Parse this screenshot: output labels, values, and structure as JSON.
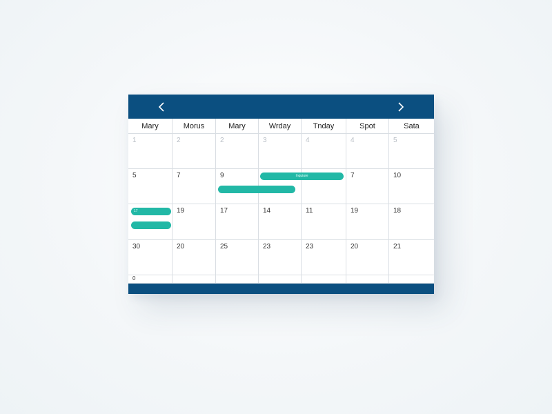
{
  "nav": {
    "prev_icon": "chevron-left-icon",
    "next_icon": "chevron-right-icon"
  },
  "weekdays": [
    "Mary",
    "Morus",
    "Mary",
    "Wrday",
    "Tnday",
    "Spot",
    "Sata"
  ],
  "weeks": [
    [
      "1",
      "2",
      "2",
      "3",
      "4",
      "4",
      "5"
    ],
    [
      "5",
      "7",
      "9",
      "",
      "",
      "7",
      "10"
    ],
    [
      "",
      "19",
      "17",
      "14",
      "11",
      "19",
      "18"
    ],
    [
      "30",
      "20",
      "25",
      "23",
      "23",
      "20",
      "21"
    ],
    [
      "0",
      "",
      "",
      "",
      "",
      "",
      ""
    ]
  ],
  "events": [
    {
      "label": "Inquiure"
    },
    {
      "label": ""
    },
    {
      "label": "17"
    },
    {
      "label": ""
    }
  ],
  "colors": {
    "header": "#0b4f80",
    "event": "#22b8a6",
    "grid_line": "#d9dee3"
  }
}
